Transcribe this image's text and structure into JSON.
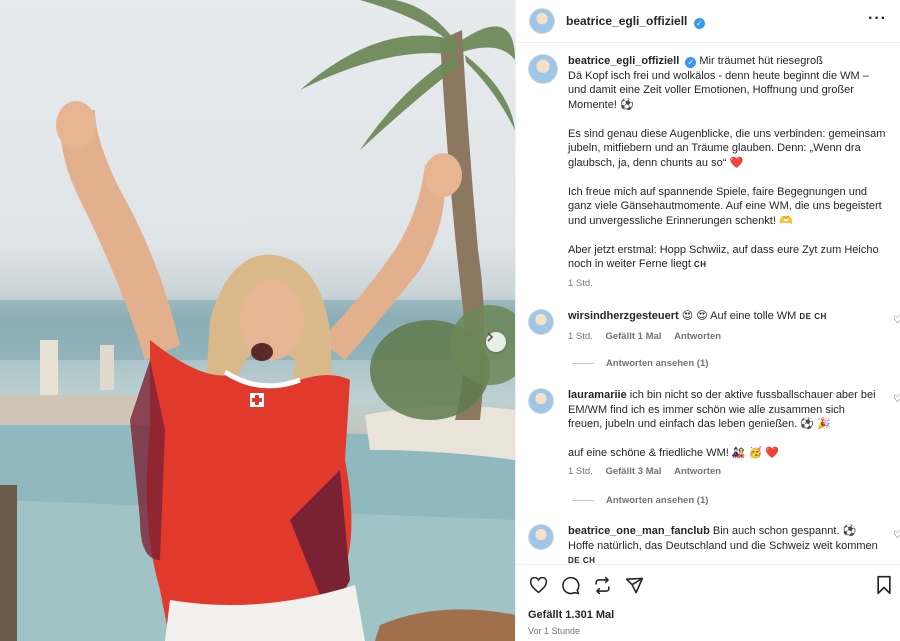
{
  "header": {
    "username": "beatrice_egli_offiziell",
    "verified": true,
    "more_icon": "more-dots-icon"
  },
  "caption": {
    "username": "beatrice_egli_offiziell",
    "title": "Mir träumet hüt riesegroß",
    "paragraphs": [
      "Dä Kopf isch frei und wolkälos - denn heute beginnt die WM – und damit eine Zeit voller Emotionen, Hoffnung und großer Momente! ⚽",
      "Es sind genau diese Augenblicke, die uns verbinden: gemeinsam jubeln, mitfiebern und an Träume glauben. Denn: „Wenn dra glaubsch, ja, denn chunts au so“ ❤️",
      "Ich freue mich auf spannende Spiele, faire Begegnungen und ganz viele Gänsehautmomente. Auf eine WM, die uns begeistert und unvergessliche Erinnerungen schenkt! 🫶",
      "Aber jetzt erstmal: Hopp Schwiiz, auf dass eure Zyt zum Heicho noch in weiter Ferne liegt"
    ],
    "last_flag": "CH",
    "time": "1 Std."
  },
  "comments": [
    {
      "username": "wirsindherzgesteuert",
      "text": "😍 😍  Auf eine tolle WM",
      "flag": "DE CH",
      "time": "1 Std.",
      "likes": "Gefällt 1 Mal",
      "reply": "Antworten",
      "view_replies": "Antworten ansehen (1)"
    },
    {
      "username": "lauramariie",
      "text": "ich bin nicht so der aktive fussballschauer aber bei EM/WM find ich es immer schön wie alle zusammen sich freuen, jubeln und einfach das leben genießen. ⚽ 🎉",
      "text2": "auf eine schöne & friedliche WM! 🎎 🥳 ❤️",
      "time": "1 Std.",
      "likes": "Gefällt 3 Mal",
      "reply": "Antworten",
      "view_replies": "Antworten ansehen (1)"
    },
    {
      "username": "beatrice_one_man_fanclub",
      "text": "Bin auch schon gespannt. ⚽ Hoffe natürlich, das Deutschland und die Schweiz weit kommen",
      "flag": "DE CH"
    }
  ],
  "footer": {
    "likes": "Gefällt 1.301 Mal",
    "time": "Vor 1 Stunde",
    "icons": [
      "heart-icon",
      "comment-icon",
      "share-icon",
      "send-icon",
      "bookmark-icon"
    ]
  }
}
